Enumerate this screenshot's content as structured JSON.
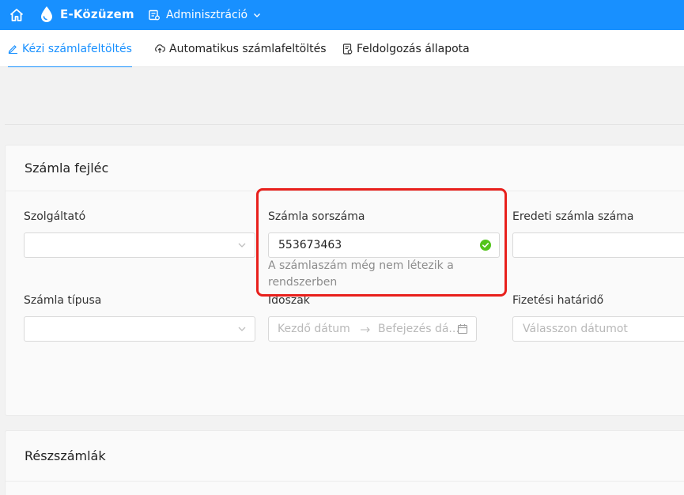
{
  "header": {
    "brand": "E-Közüzem",
    "menu_label": "Adminisztráció",
    "colors": {
      "primary": "#1890ff",
      "highlight": "#e8201c",
      "success": "#52c41a"
    }
  },
  "tabs": [
    {
      "label": "Kézi számlafeltöltés",
      "icon": "pencil-icon",
      "active": true
    },
    {
      "label": "Automatikus számlafeltöltés",
      "icon": "cloud-upload-icon",
      "active": false
    },
    {
      "label": "Feldolgozás állapota",
      "icon": "document-status-icon",
      "active": false
    }
  ],
  "invoice_header": {
    "title": "Számla fejléc",
    "provider": {
      "label": "Szolgáltató",
      "value": ""
    },
    "invoice_number": {
      "label": "Számla sorszáma",
      "value": "553673463",
      "status": "valid",
      "help": "A számlaszám még nem létezik a rendszerben"
    },
    "original_invoice_number": {
      "label": "Eredeti számla száma",
      "value": ""
    },
    "invoice_type": {
      "label": "Számla típusa",
      "value": ""
    },
    "period": {
      "label": "Időszak",
      "start_placeholder": "Kezdő dátum",
      "end_placeholder": "Befejezés dá..."
    },
    "due_date": {
      "label": "Fizetési határidő",
      "placeholder": "Válasszon dátumot"
    }
  },
  "partial_invoices": {
    "title": "Részszámlák"
  }
}
